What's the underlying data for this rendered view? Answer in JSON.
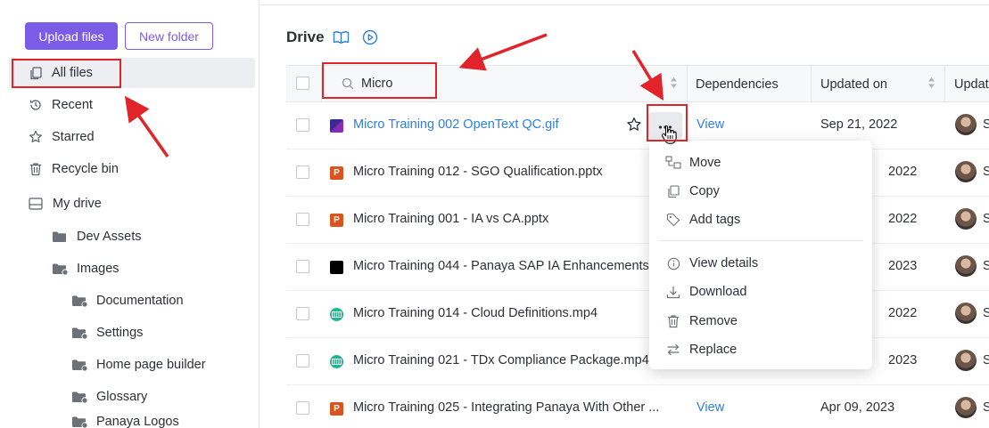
{
  "sidebar": {
    "upload_label": "Upload files",
    "new_folder_label": "New folder",
    "nav": [
      {
        "label": "All files",
        "icon": "files-icon"
      },
      {
        "label": "Recent",
        "icon": "history-icon"
      },
      {
        "label": "Starred",
        "icon": "star-icon"
      },
      {
        "label": "Recycle bin",
        "icon": "trash-icon"
      },
      {
        "label": "My drive",
        "icon": "drive-icon"
      }
    ],
    "folders": [
      {
        "label": "Dev Assets"
      },
      {
        "label": "Images"
      },
      {
        "label": "Documentation"
      },
      {
        "label": "Settings"
      },
      {
        "label": "Home page builder"
      },
      {
        "label": "Glossary"
      },
      {
        "label": "Panaya Logos"
      }
    ]
  },
  "main": {
    "title": "Drive",
    "search_value": "Micro",
    "columns": [
      "Dependencies",
      "Updated on",
      "Updat"
    ],
    "rows": [
      {
        "name": "Micro Training 002 OpenText QC.gif",
        "type": "gif",
        "view": "View",
        "date": "Sep 21, 2022",
        "initial": "S"
      },
      {
        "name": "Micro Training 012 - SGO Qualification.pptx",
        "type": "pptx",
        "view": "",
        "date": "2022",
        "initial": "S"
      },
      {
        "name": "Micro Training 001 - IA vs CA.pptx",
        "type": "pptx",
        "view": "",
        "date": "2022",
        "initial": "S"
      },
      {
        "name": "Micro Training 044 - Panaya SAP IA Enhancements",
        "type": "video-black",
        "view": "",
        "date": "2023",
        "initial": "S"
      },
      {
        "name": "Micro Training 014 - Cloud Definitions.mp4",
        "type": "mp4",
        "view": "",
        "date": "2022",
        "initial": "S"
      },
      {
        "name": "Micro Training 021 - TDx Compliance Package.mp4",
        "type": "mp4",
        "view": "",
        "date": "2023",
        "initial": "S"
      },
      {
        "name": "Micro Training 025 - Integrating Panaya With Other ...",
        "type": "pptx",
        "view": "View",
        "date": "Apr 09, 2023",
        "initial": "S"
      }
    ],
    "pptx_letter": "P"
  },
  "context_menu": {
    "items": [
      {
        "label": "Move",
        "icon": "move-icon"
      },
      {
        "label": "Copy",
        "icon": "copy-icon"
      },
      {
        "label": "Add tags",
        "icon": "tag-icon"
      },
      {
        "label": "View details",
        "icon": "info-icon"
      },
      {
        "label": "Download",
        "icon": "download-icon"
      },
      {
        "label": "Remove",
        "icon": "trash-icon"
      },
      {
        "label": "Replace",
        "icon": "replace-icon"
      }
    ]
  },
  "colors": {
    "accent": "#7b5ce6",
    "link": "#2f80d8",
    "annotation": "#e0242a",
    "pptx": "#d9541e",
    "mp4": "#1fb58f"
  }
}
